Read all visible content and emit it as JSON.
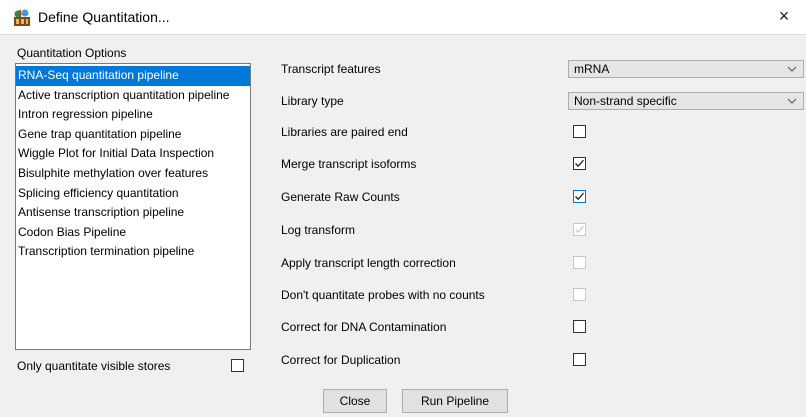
{
  "window": {
    "title": "Define Quantitation...",
    "close_symbol": "×"
  },
  "left_panel": {
    "header": "Quantitation Options",
    "items": [
      "RNA-Seq quantitation pipeline",
      "Active transcription quantitation pipeline",
      "Intron regression pipeline",
      "Gene trap quantitation pipeline",
      "Wiggle Plot for Initial Data Inspection",
      "Bisulphite methylation over features",
      "Splicing efficiency quantitation",
      "Antisense transcription pipeline",
      "Codon Bias Pipeline",
      "Transcription termination pipeline"
    ],
    "selected_index": 0,
    "visible_stores": {
      "label": "Only quantitate visible stores",
      "checked": false
    }
  },
  "options": {
    "transcript_features": {
      "label": "Transcript features",
      "value": "mRNA"
    },
    "library_type": {
      "label": "Library type",
      "value": "Non-strand specific"
    },
    "paired_end": {
      "label": "Libraries are paired end",
      "checked": false,
      "enabled": true
    },
    "merge_isoforms": {
      "label": "Merge transcript isoforms",
      "checked": true,
      "enabled": true
    },
    "raw_counts": {
      "label": "Generate Raw Counts",
      "checked": true,
      "enabled": true
    },
    "log_transform": {
      "label": "Log transform",
      "checked": true,
      "enabled": false
    },
    "length_correction": {
      "label": "Apply transcript length correction",
      "checked": false,
      "enabled": false
    },
    "no_count_probes": {
      "label": "Don't quantitate probes with no counts",
      "checked": false,
      "enabled": false
    },
    "dna_contamination": {
      "label": "Correct for DNA Contamination",
      "checked": false,
      "enabled": true
    },
    "duplication": {
      "label": "Correct for Duplication",
      "checked": false,
      "enabled": true
    }
  },
  "buttons": {
    "close": "Close",
    "run": "Run Pipeline"
  },
  "colors": {
    "selection": "#0078d7",
    "background": "#f0f0f0"
  }
}
